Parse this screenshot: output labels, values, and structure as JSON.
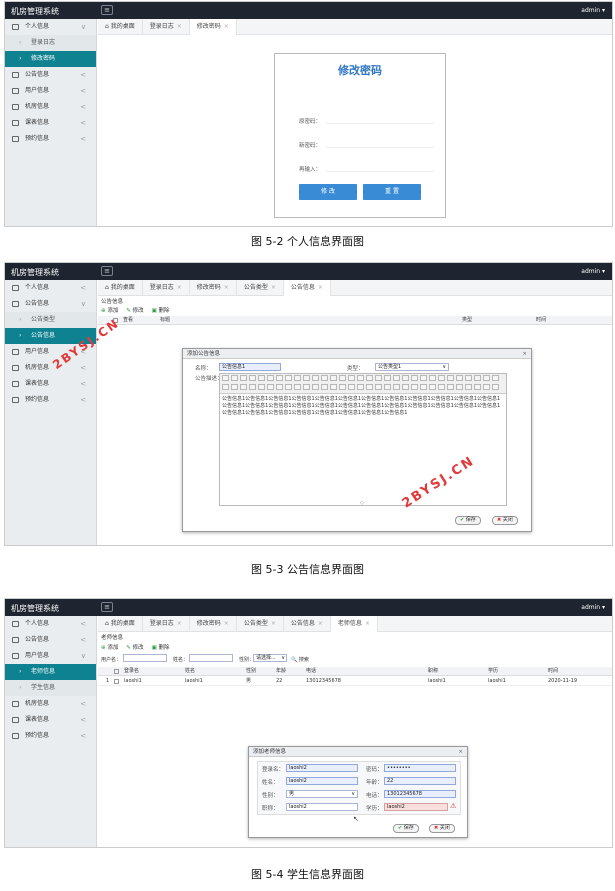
{
  "common": {
    "app_title": "机房管理系统",
    "admin": "admin",
    "menu_icon": "hamburger-icon"
  },
  "shot1": {
    "menu": [
      {
        "label": "个人信息",
        "icon": "user-icon",
        "arrow": "∨"
      },
      {
        "label": "登录日志",
        "sub": true
      },
      {
        "label": "修改密码",
        "sub": true,
        "active": true
      },
      {
        "label": "公告信息",
        "icon": "notice-icon",
        "arrow": "<"
      },
      {
        "label": "用户信息",
        "icon": "users-icon",
        "arrow": "<"
      },
      {
        "label": "机房信息",
        "icon": "room-icon",
        "arrow": "<"
      },
      {
        "label": "课表信息",
        "icon": "schedule-icon",
        "arrow": "<"
      },
      {
        "label": "预约信息",
        "icon": "booking-icon",
        "arrow": "<"
      }
    ],
    "tabs": [
      "我的桌面",
      "登录日志",
      "修改密码"
    ],
    "title": "修改密码",
    "fields": [
      "原密码：",
      "新密码：",
      "再输入："
    ],
    "btn_submit": "修 改",
    "btn_reset": "重 置",
    "caption": "图 5-2  个人信息界面图"
  },
  "shot2": {
    "menu": [
      {
        "label": "个人信息",
        "icon": "user-icon",
        "arrow": "<"
      },
      {
        "label": "公告信息",
        "icon": "notice-icon",
        "arrow": "∨"
      },
      {
        "label": "公告类型",
        "sub": true
      },
      {
        "label": "公告信息",
        "sub": true,
        "active": true
      },
      {
        "label": "用户信息",
        "icon": "users-icon",
        "arrow": "<"
      },
      {
        "label": "机房信息",
        "icon": "room-icon",
        "arrow": "<"
      },
      {
        "label": "课表信息",
        "icon": "schedule-icon",
        "arrow": "<"
      },
      {
        "label": "预约信息",
        "icon": "booking-icon",
        "arrow": "<"
      }
    ],
    "tabs": [
      "我的桌面",
      "登录日志",
      "修改密码",
      "公告类型",
      "公告信息"
    ],
    "panel_title": "公告信息",
    "toolbar": {
      "add": "添加",
      "edit": "修改",
      "del": "删除"
    },
    "columns": [
      "查看",
      "标题",
      "类型",
      "时间"
    ],
    "dialog": {
      "title": "添加公告信息",
      "name_label": "名称：",
      "name_value": "公告信息1",
      "type_label": "类型：",
      "type_value": "公告类型1",
      "desc_label": "公告描述：",
      "content": "公告信息1公告信息1公告信息1公告信息1公告信息1公告信息1公告信息1公告信息1公告信息1公告信息1公告信息1公告信息1公告信息1公告信息1公告信息1公告信息1公告信息1公告信息1公告信息1公告信息1公告信息1公告信息1公告信息1公告信息1公告信息1公告信息1公告信息1公告信息1公告信息1公告信息1公告信息1公告信息1",
      "save": "保存",
      "close": "关闭"
    },
    "watermark_a": "2BYSJ.CN",
    "watermark_b": "2BYSJ.CN",
    "caption": "图 5-3  公告信息界面图"
  },
  "shot3": {
    "menu": [
      {
        "label": "个人信息",
        "icon": "user-icon",
        "arrow": "<"
      },
      {
        "label": "公告信息",
        "icon": "notice-icon",
        "arrow": "<"
      },
      {
        "label": "用户信息",
        "icon": "users-icon",
        "arrow": "∨"
      },
      {
        "label": "老师信息",
        "sub": true,
        "active": true
      },
      {
        "label": "学生信息",
        "sub": true
      },
      {
        "label": "机房信息",
        "icon": "room-icon",
        "arrow": "<"
      },
      {
        "label": "课表信息",
        "icon": "schedule-icon",
        "arrow": "<"
      },
      {
        "label": "预约信息",
        "icon": "booking-icon",
        "arrow": "<"
      }
    ],
    "tabs": [
      "我的桌面",
      "登录日志",
      "修改密码",
      "公告类型",
      "公告信息",
      "老师信息"
    ],
    "panel_title": "老师信息",
    "toolbar": {
      "add": "添加",
      "edit": "修改",
      "del": "删除"
    },
    "search": {
      "user_label": "用户名：",
      "name_label": "姓名：",
      "gender_label": "性别：",
      "gender_value": "请选择...",
      "search_btn": "搜索"
    },
    "columns": [
      "登录名",
      "姓名",
      "性别",
      "年龄",
      "电话",
      "职称",
      "学历",
      "时间"
    ],
    "row": {
      "index": "1",
      "login": "laoshi1",
      "name": "laoshi1",
      "gender": "男",
      "age": "22",
      "phone": "13012345678",
      "title": "laoshi1",
      "edu": "laoshi1",
      "time": "2020-11-19"
    },
    "dialog": {
      "title": "添加老师信息",
      "login_label": "登录名：",
      "login_value": "laoshi2",
      "pwd_label": "密码：",
      "pwd_value": "••••••••",
      "name_label": "姓名：",
      "name_value": "laoshi2",
      "age_label": "年龄：",
      "age_value": "22",
      "gender_label": "性别：",
      "gender_value": "男",
      "phone_label": "电话：",
      "phone_value": "13012345678",
      "title_label": "职称：",
      "title_value": "laoshi2",
      "edu_label": "学历：",
      "edu_value": "laoshi2",
      "save": "保存",
      "close": "关闭"
    },
    "caption": "图 5-4  学生信息界面图"
  }
}
